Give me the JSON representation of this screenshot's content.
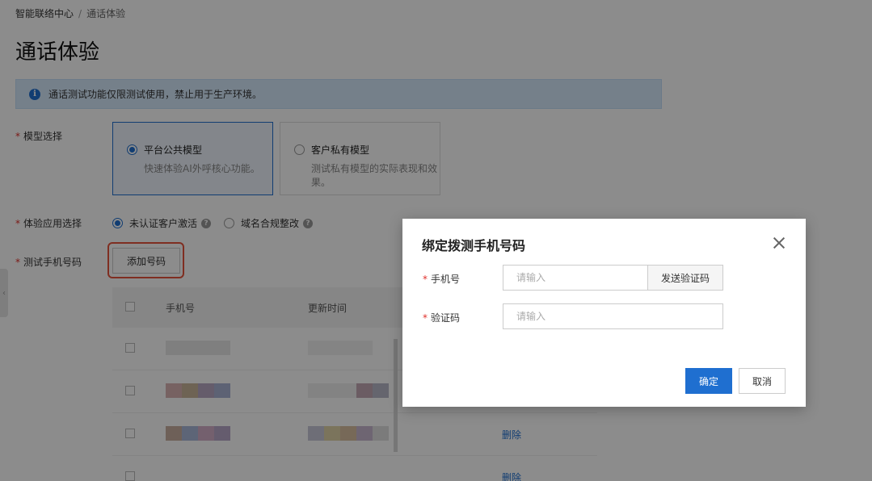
{
  "breadcrumb": {
    "root": "智能联络中心",
    "separator": "/",
    "current": "通话体验"
  },
  "page_title": "通话体验",
  "notice": {
    "icon": "info-icon",
    "text": "通话测试功能仅限测试使用，禁止用于生产环境。"
  },
  "model_select": {
    "label": "模型选择",
    "options": [
      {
        "title": "平台公共模型",
        "desc": "快速体验AI外呼核心功能。",
        "selected": true
      },
      {
        "title": "客户私有模型",
        "desc": "测试私有模型的实际表现和效果。",
        "selected": false
      }
    ]
  },
  "app_select": {
    "label": "体验应用选择",
    "options": [
      {
        "label": "未认证客户激活",
        "selected": true
      },
      {
        "label": "域名合规整改",
        "selected": false
      }
    ]
  },
  "test_phone": {
    "label": "测试手机号码",
    "add_button": "添加号码"
  },
  "table": {
    "headers": [
      "手机号",
      "更新时间"
    ],
    "rows": [
      {
        "action": ""
      },
      {
        "action": ""
      },
      {
        "action": "删除"
      },
      {
        "action": "删除"
      }
    ]
  },
  "dialog": {
    "title": "绑定拨测手机号码",
    "phone_label": "手机号",
    "phone_placeholder": "请输入",
    "send_code": "发送验证码",
    "code_label": "验证码",
    "code_placeholder": "请输入",
    "ok": "确定",
    "cancel": "取消"
  },
  "colors": {
    "primary": "#1f6fd0",
    "required": "#e0302b",
    "highlight": "#e8553c"
  }
}
